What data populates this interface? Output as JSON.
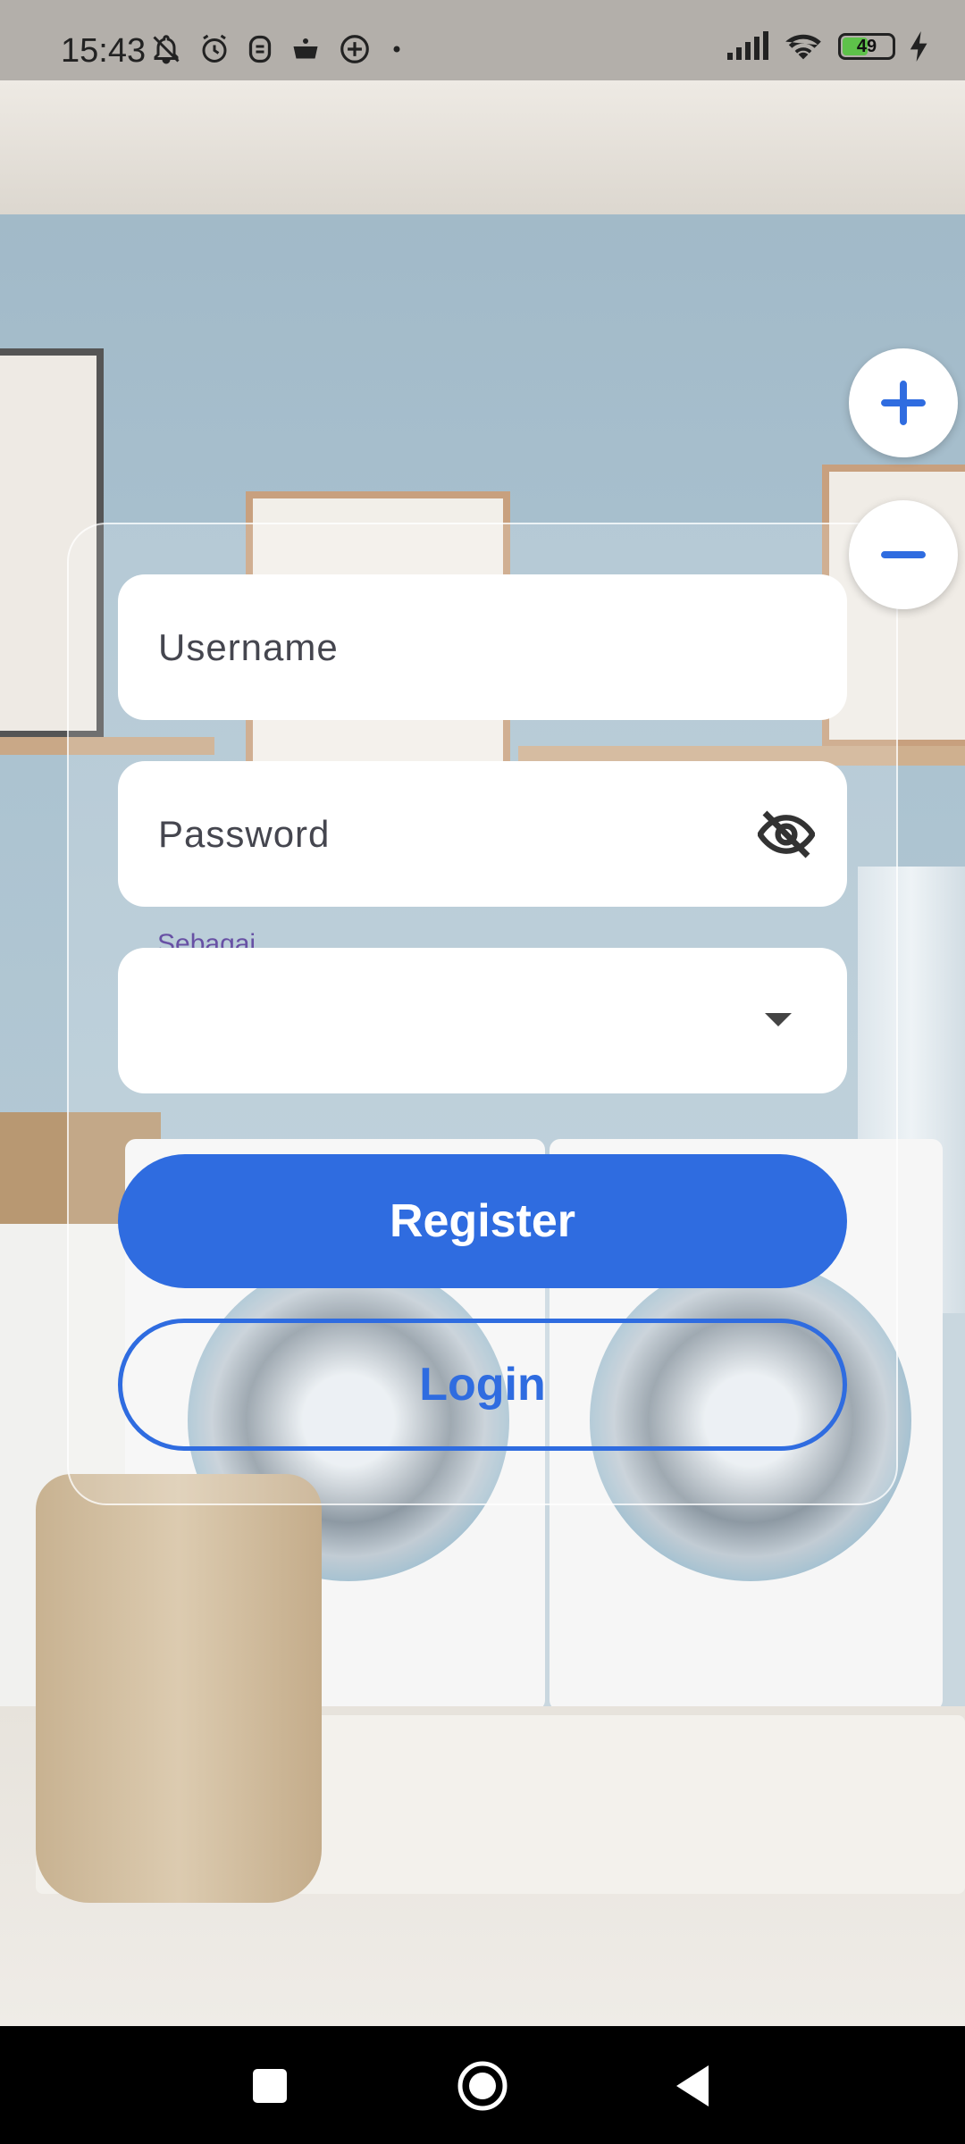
{
  "status_bar": {
    "time": "15:43",
    "left_icons": [
      "bell-off-icon",
      "alarm-icon",
      "app-icon",
      "pot-icon",
      "add-circle-icon",
      "dot-icon"
    ],
    "right_icons": [
      "signal-icon",
      "wifi-icon",
      "battery-icon",
      "charging-icon"
    ],
    "battery_level": "49",
    "battery_fraction": 0.49,
    "battery_color": "#5ec24a"
  },
  "zoom": {
    "in_symbol": "+",
    "out_symbol": "−"
  },
  "form": {
    "username_placeholder": "Username",
    "password_placeholder": "Password",
    "role_label": "Sebagai",
    "role_value": "",
    "register_label": "Register",
    "login_label": "Login"
  },
  "colors": {
    "primary": "#2f6ce0",
    "label_purple": "#6750a4",
    "field_bg": "#ffffff"
  },
  "nav_bar": {
    "buttons": [
      "recent-apps-icon",
      "home-icon",
      "back-icon"
    ]
  }
}
